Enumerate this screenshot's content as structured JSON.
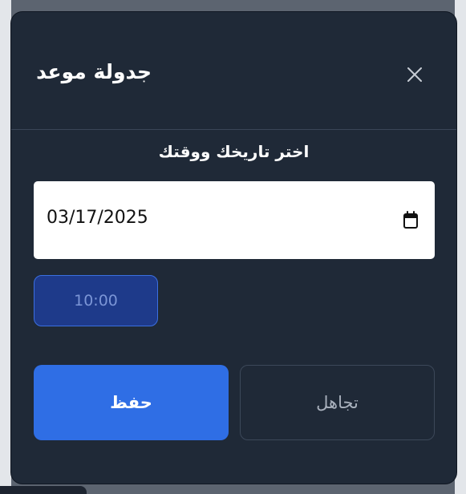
{
  "dialog": {
    "title": "جدولة موعد",
    "close_icon": "close-icon",
    "prompt": "اختر تاريخك ووقتك",
    "date": {
      "value": "03/17/2025",
      "icon": "calendar-icon"
    },
    "time_option": "10:00",
    "buttons": {
      "save_label": "حفظ",
      "ignore_label": "تجاهل"
    }
  },
  "colors": {
    "dialog_bg": "#1f2937",
    "primary": "#2f6ee5",
    "time_chip_bg": "#1e3a8a",
    "time_chip_border": "#3b6fe0",
    "field_bg": "#ffffff"
  }
}
